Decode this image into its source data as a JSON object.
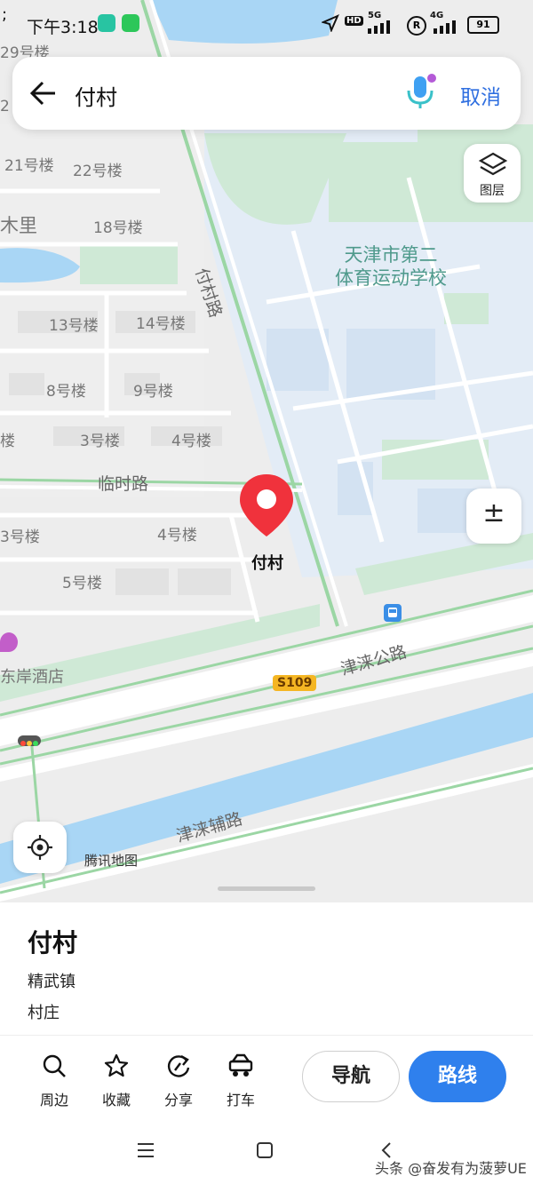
{
  "status": {
    "leading": ";",
    "time": "下午3:18",
    "battery": "91",
    "net1": "5G",
    "net2": "4G",
    "hd": "HD",
    "r": "R"
  },
  "search": {
    "query": "付村",
    "cancel_label": "取消"
  },
  "map": {
    "layer_label": "图层",
    "zoom_label": "±",
    "pin_label": "付村",
    "provider": "腾讯地图",
    "school": [
      "天津市第二",
      "体育运动学校"
    ],
    "road_fucun": "付村路",
    "road_linshi": "临时路",
    "road_jinlai": "津涞公路",
    "road_fulu": "津涞辅路",
    "shield": "S109",
    "hotel": "东岸酒店",
    "buildings": [
      "29号楼",
      "21号楼",
      "22号楼",
      "18号楼",
      "13号楼",
      "14号楼",
      "8号楼",
      "9号楼",
      "3号楼",
      "4号楼",
      "4号楼",
      "5号楼",
      "3号楼",
      "木里",
      "楼",
      "2"
    ]
  },
  "place": {
    "name": "付村",
    "town": "精武镇",
    "category": "村庄"
  },
  "actions": [
    {
      "label": "周边"
    },
    {
      "label": "收藏"
    },
    {
      "label": "分享"
    },
    {
      "label": "打车"
    }
  ],
  "nav_label": "导航",
  "route_label": "路线",
  "watermark": "头条 @奋发有为菠萝UE",
  "colors": {
    "accent": "#2f80ed",
    "pin": "#f0323c",
    "water": "#a9d6f5",
    "green": "#cdeacf",
    "campus": "#e4edf7"
  }
}
